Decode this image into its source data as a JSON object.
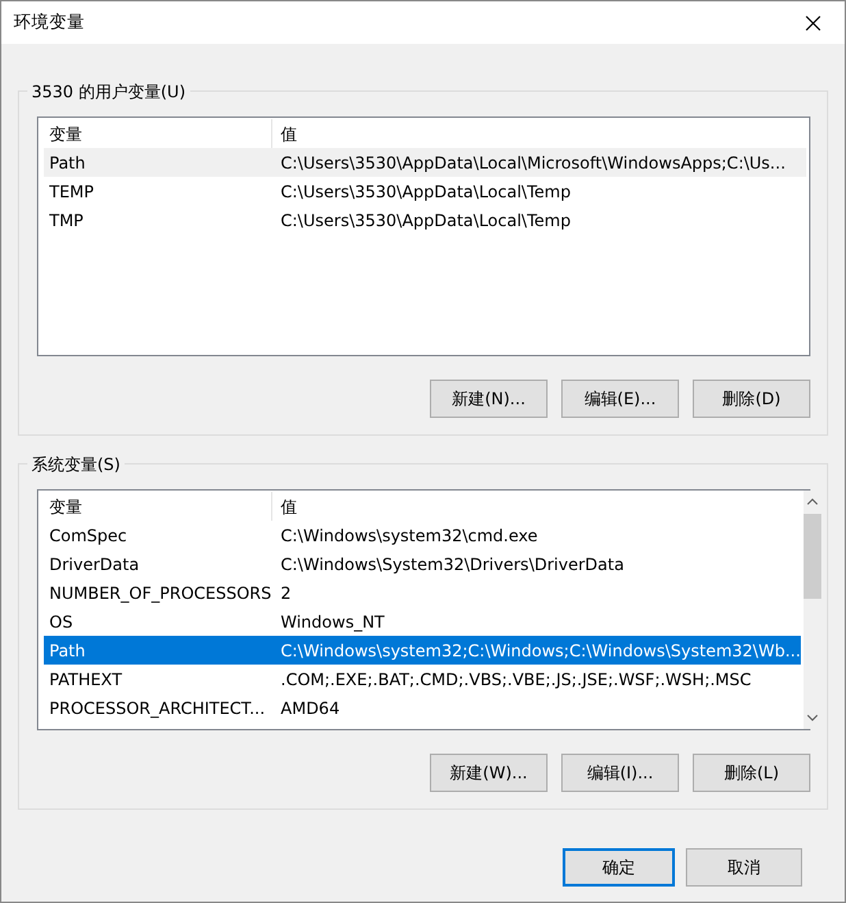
{
  "window": {
    "title": "环境变量"
  },
  "user_group": {
    "title": "3530 的用户变量(U)",
    "focused": false,
    "columns": [
      "变量",
      "值"
    ],
    "rows": [
      {
        "cells": [
          "Path",
          "C:\\Users\\3530\\AppData\\Local\\Microsoft\\WindowsApps;C:\\Us..."
        ],
        "selected": true
      },
      {
        "cells": [
          "TEMP",
          "C:\\Users\\3530\\AppData\\Local\\Temp"
        ],
        "selected": false
      },
      {
        "cells": [
          "TMP",
          "C:\\Users\\3530\\AppData\\Local\\Temp"
        ],
        "selected": false
      }
    ],
    "buttons": [
      "新建(N)...",
      "编辑(E)...",
      "删除(D)"
    ]
  },
  "system_group": {
    "title": "系统变量(S)",
    "focused": true,
    "columns": [
      "变量",
      "值"
    ],
    "rows": [
      {
        "cells": [
          "ComSpec",
          "C:\\Windows\\system32\\cmd.exe"
        ],
        "selected": false
      },
      {
        "cells": [
          "DriverData",
          "C:\\Windows\\System32\\Drivers\\DriverData"
        ],
        "selected": false
      },
      {
        "cells": [
          "NUMBER_OF_PROCESSORS",
          "2"
        ],
        "selected": false
      },
      {
        "cells": [
          "OS",
          "Windows_NT"
        ],
        "selected": false
      },
      {
        "cells": [
          "Path",
          "C:\\Windows\\system32;C:\\Windows;C:\\Windows\\System32\\Wb..."
        ],
        "selected": true
      },
      {
        "cells": [
          "PATHEXT",
          ".COM;.EXE;.BAT;.CMD;.VBS;.VBE;.JS;.JSE;.WSF;.WSH;.MSC"
        ],
        "selected": false
      },
      {
        "cells": [
          "PROCESSOR_ARCHITECT...",
          "AMD64"
        ],
        "selected": false
      }
    ],
    "buttons": [
      "新建(W)...",
      "编辑(I)...",
      "删除(L)"
    ]
  },
  "footer_buttons": [
    {
      "label": "确定",
      "default": true
    },
    {
      "label": "取消",
      "default": false
    }
  ]
}
